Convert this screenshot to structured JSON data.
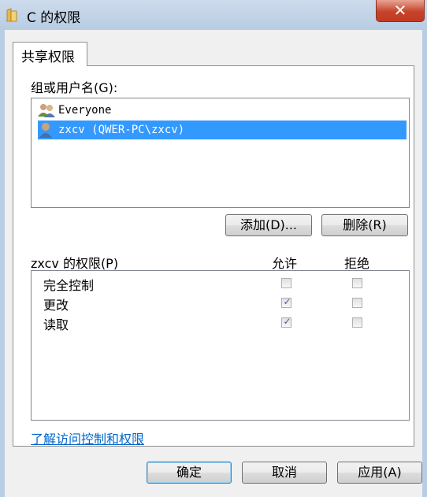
{
  "window": {
    "title": "C 的权限",
    "close_label": "✕"
  },
  "tab": {
    "label": "共享权限"
  },
  "groups": {
    "label": "组或用户名(G):",
    "items": [
      {
        "name": "Everyone",
        "icon": "users-group-icon",
        "selected": false
      },
      {
        "name": "zxcv (QWER-PC\\zxcv)",
        "icon": "user-icon",
        "selected": true
      }
    ]
  },
  "buttons": {
    "add": "添加(D)...",
    "remove": "删除(R)"
  },
  "permissions": {
    "label": "zxcv 的权限(P)",
    "col_allow": "允许",
    "col_deny": "拒绝",
    "rows": [
      {
        "name": "完全控制",
        "allow": false,
        "deny": false
      },
      {
        "name": "更改",
        "allow": true,
        "deny": false
      },
      {
        "name": "读取",
        "allow": true,
        "deny": false
      }
    ]
  },
  "link": {
    "text": "了解访问控制和权限"
  },
  "footer": {
    "ok": "确定",
    "cancel": "取消",
    "apply": "应用(A)"
  },
  "colors": {
    "selection": "#3399ff",
    "link": "#0066cc",
    "close": "#c7432a"
  }
}
